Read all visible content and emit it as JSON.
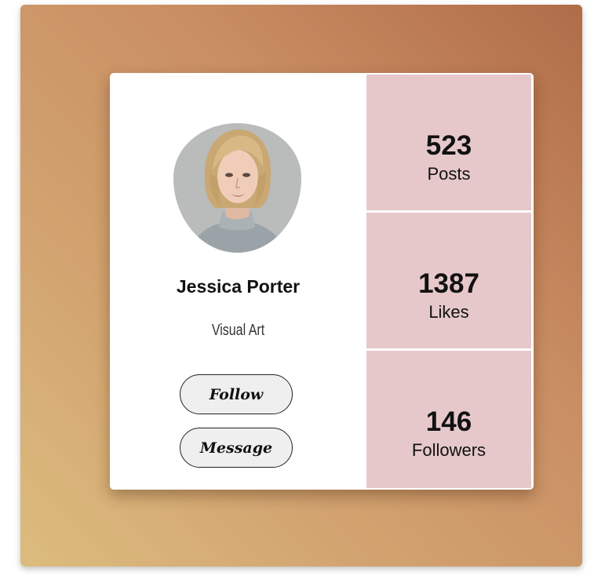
{
  "profile": {
    "name": "Jessica Porter",
    "role": "Visual Art",
    "avatar_icon": "portrait-photo"
  },
  "actions": {
    "follow_label": "Follow",
    "message_label": "Message"
  },
  "stats": [
    {
      "value": "523",
      "label": "Posts"
    },
    {
      "value": "1387",
      "label": "Likes"
    },
    {
      "value": "146",
      "label": "Followers"
    }
  ],
  "colors": {
    "background_gradient_start": "#b06c49",
    "background_gradient_end": "#dcbc7e",
    "stat_panel": "#e6c8cb",
    "button_bg": "#efefef"
  }
}
